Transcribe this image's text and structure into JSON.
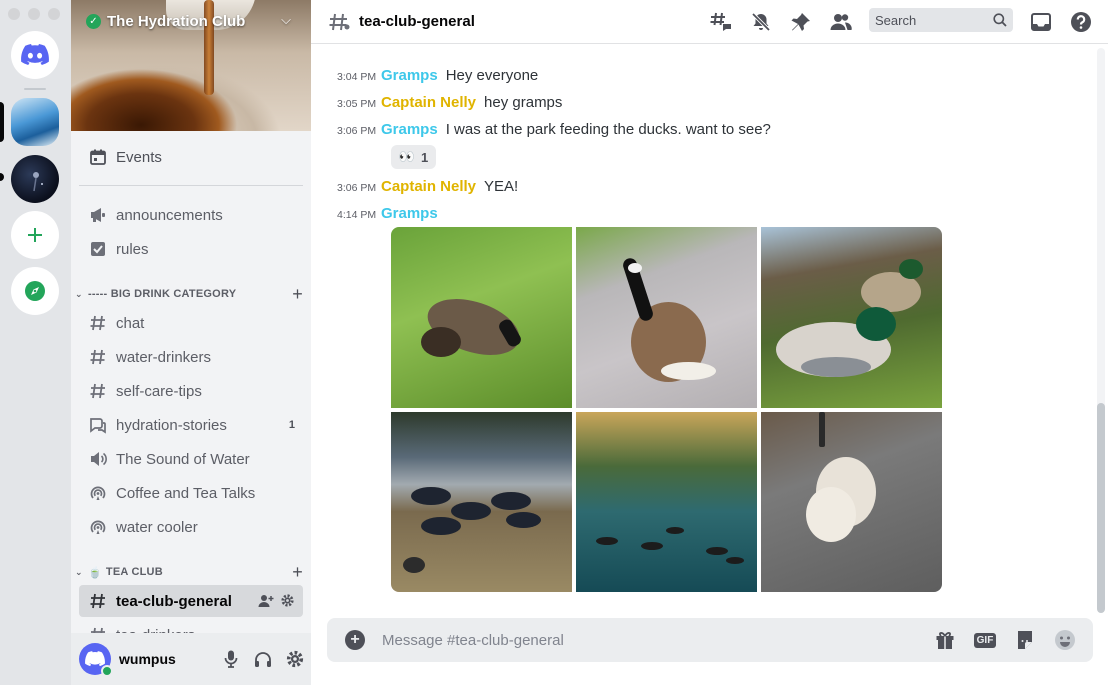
{
  "server": {
    "name": "The Hydration Club",
    "verified": true
  },
  "sidebar": {
    "events_label": "Events",
    "top_channels": [
      {
        "name": "announcements",
        "icon": "megaphone-icon"
      },
      {
        "name": "rules",
        "icon": "checkbox-icon"
      }
    ],
    "categories": [
      {
        "name": "----- BIG DRINK CATEGORY",
        "channels": [
          {
            "name": "chat",
            "icon": "hash-icon"
          },
          {
            "name": "water-drinkers",
            "icon": "hash-icon"
          },
          {
            "name": "self-care-tips",
            "icon": "hash-icon"
          },
          {
            "name": "hydration-stories",
            "icon": "forum-icon",
            "badge": "1"
          },
          {
            "name": "The Sound of Water",
            "icon": "speaker-icon"
          },
          {
            "name": "Coffee and Tea Talks",
            "icon": "stage-icon"
          },
          {
            "name": "water cooler",
            "icon": "stage-icon"
          }
        ]
      },
      {
        "name": "TEA CLUB",
        "emoji": "🍵",
        "channels": [
          {
            "name": "tea-club-general",
            "icon": "hash-icon",
            "active": true
          },
          {
            "name": "tea-drinkers",
            "icon": "hash-icon"
          }
        ]
      }
    ]
  },
  "user": {
    "name": "wumpus",
    "status_color": "#23a55a"
  },
  "header": {
    "channel_name": "tea-club-general",
    "search_placeholder": "Search"
  },
  "messages": [
    {
      "time": "3:04 PM",
      "author": "Gramps",
      "text": "Hey everyone"
    },
    {
      "time": "3:05 PM",
      "author": "Captain Nelly",
      "text": "hey gramps"
    },
    {
      "time": "3:06 PM",
      "author": "Gramps",
      "text": "I was at the park feeding the ducks. want to see?"
    },
    {
      "time": "3:06 PM",
      "author": "Captain Nelly",
      "text": "YEA!"
    },
    {
      "time": "4:14 PM",
      "author": "Gramps",
      "text": ""
    }
  ],
  "reaction": {
    "emoji": "👀",
    "count": "1"
  },
  "composer": {
    "placeholder": "Message #tea-club-general",
    "gif_label": "GIF"
  },
  "colors": {
    "gramps": "#3ec8ea",
    "captain_nelly": "#e0b400",
    "accent": "#5865f2",
    "green": "#23a55a"
  }
}
